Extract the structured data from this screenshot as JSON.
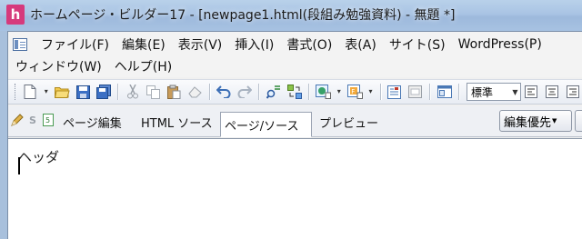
{
  "titlebar": {
    "app_icon_letter": "h",
    "app_icon_color": "#d63a7c",
    "title": "ホームページ・ビルダー17 - [newpage1.html(段組み勉強資料) - 無題 *]"
  },
  "menu": {
    "row1": [
      "ファイル(F)",
      "編集(E)",
      "表示(V)",
      "挿入(I)",
      "書式(O)",
      "表(A)",
      "サイト(S)",
      "WordPress(P)"
    ],
    "row2": [
      "ウィンドウ(W)",
      "ヘルプ(H)"
    ]
  },
  "toolbar": {
    "icons": [
      "new-document-icon",
      "open-folder-icon",
      "save-icon",
      "save-all-icon",
      "cut-icon",
      "copy-icon",
      "paste-icon",
      "eraser-icon",
      "undo-icon",
      "redo-icon",
      "find-icon",
      "replace-icon",
      "page-properties-icon",
      "insert-image-icon",
      "link-icon",
      "form-icon",
      "layout-icon"
    ],
    "style_value": "標準"
  },
  "tabs": {
    "items": [
      "ページ編集",
      "HTML ソース",
      "ページ/ソース",
      "プレビュー"
    ],
    "active": "ページ/ソース",
    "edit_priority_label": "編集優先"
  },
  "editor": {
    "content": "ヘッダ"
  },
  "colors": {
    "titlebar": "#a9c4e4",
    "menubar": "#f3f3f3",
    "editor": "#ffffff"
  }
}
